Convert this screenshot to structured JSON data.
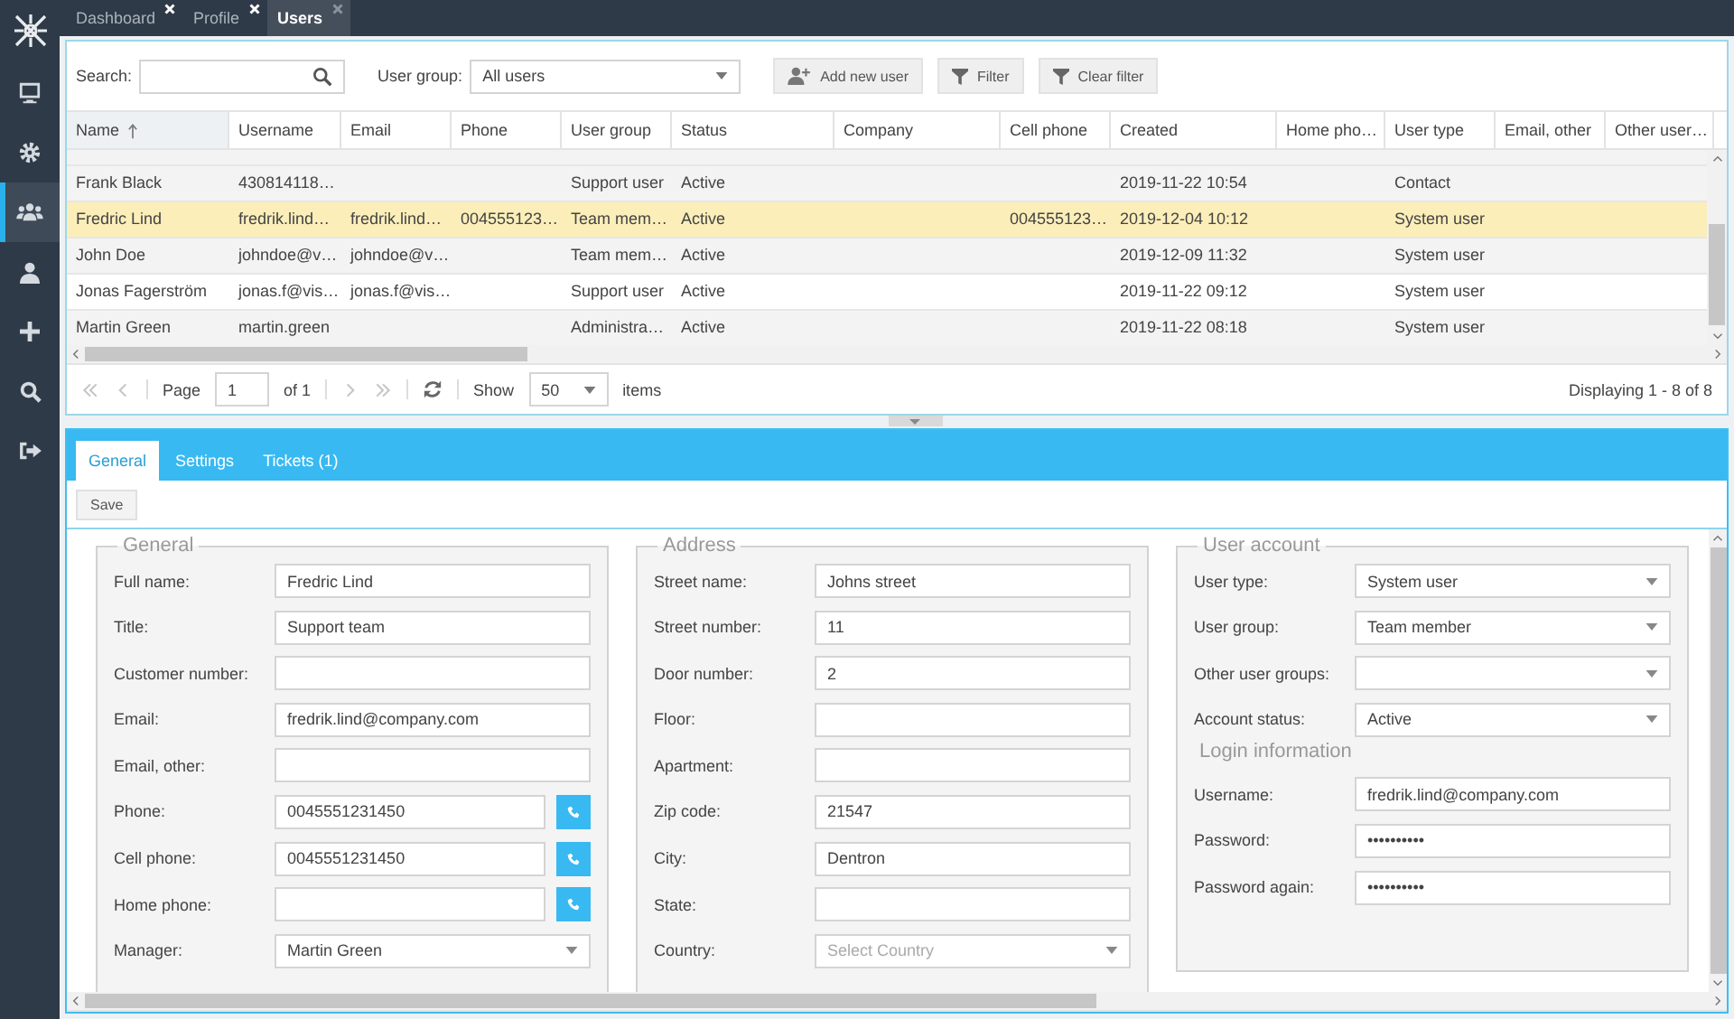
{
  "sidebar": {
    "items": [
      {
        "selected": false
      },
      {
        "selected": false
      },
      {
        "selected": true
      },
      {
        "selected": false
      },
      {
        "selected": false
      },
      {
        "selected": false
      },
      {
        "selected": false
      }
    ]
  },
  "tabs": [
    {
      "label": "Dashboard",
      "selected": false
    },
    {
      "label": "Profile",
      "selected": false
    },
    {
      "label": "Users",
      "selected": true
    }
  ],
  "toolbar": {
    "search_label": "Search:",
    "group_label": "User group:",
    "group_value": "All users",
    "buttons": [
      {
        "label": "Add new user"
      },
      {
        "label": "Filter"
      },
      {
        "label": "Clear filter"
      }
    ]
  },
  "table": {
    "columns": [
      {
        "label": "Name",
        "sorted": true
      },
      {
        "label": "Username",
        "sorted": false
      },
      {
        "label": "Email",
        "sorted": false
      },
      {
        "label": "Phone",
        "sorted": false
      },
      {
        "label": "User group",
        "sorted": false
      },
      {
        "label": "Status",
        "sorted": false
      },
      {
        "label": "Company",
        "sorted": false
      },
      {
        "label": "Cell phone",
        "sorted": false
      },
      {
        "label": "Created",
        "sorted": false
      },
      {
        "label": "Home pho…",
        "sorted": false
      },
      {
        "label": "User type",
        "sorted": false
      },
      {
        "label": "Email, other",
        "sorted": false
      },
      {
        "label": "Other user…",
        "sorted": false
      }
    ],
    "rows": [
      {
        "selected": false,
        "cells": [
          "Frank Black",
          "430814118…",
          null,
          null,
          "Support user",
          "Active",
          null,
          null,
          "2019-11-22 10:54",
          null,
          "Contact",
          null,
          null
        ]
      },
      {
        "selected": true,
        "cells": [
          "Fredric Lind",
          "fredrik.lind…",
          "fredrik.lind…",
          "004555123…",
          "Team mem…",
          "Active",
          null,
          "004555123…",
          "2019-12-04 10:12",
          null,
          "System user",
          null,
          null
        ]
      },
      {
        "selected": false,
        "cells": [
          "John Doe",
          "johndoe@v…",
          "johndoe@v…",
          null,
          "Team mem…",
          "Active",
          null,
          null,
          "2019-12-09 11:32",
          null,
          "System user",
          null,
          null
        ]
      },
      {
        "selected": false,
        "cells": [
          "Jonas Fagerström",
          "jonas.f@vis…",
          "jonas.f@vis…",
          null,
          "Support user",
          "Active",
          null,
          null,
          "2019-11-22 09:12",
          null,
          "System user",
          null,
          null
        ]
      },
      {
        "selected": false,
        "cells": [
          "Martin Green",
          "martin.green",
          null,
          null,
          "Administra…",
          "Active",
          null,
          null,
          "2019-11-22 08:18",
          null,
          "System user",
          null,
          null
        ]
      }
    ]
  },
  "pager": {
    "nav": [
      {
        "kind": "first",
        "disabled": true
      },
      {
        "kind": "prev",
        "disabled": true
      },
      {
        "kind": "next",
        "disabled": true
      },
      {
        "kind": "last",
        "disabled": true
      }
    ],
    "page_label": "Page",
    "page": "1",
    "of": "of 1",
    "show_label": "Show",
    "page_size": "50",
    "items_label": "items",
    "summary": "Displaying 1 - 8 of 8"
  },
  "detail": {
    "tabs": [
      {
        "label": "General",
        "selected": true
      },
      {
        "label": "Settings",
        "selected": false
      },
      {
        "label": "Tickets (1)",
        "selected": false
      }
    ],
    "save": "Save",
    "fieldsets": [
      {
        "legend": "General",
        "fields": [
          {
            "kind": "text",
            "label": "Full name:",
            "value": "Fredric Lind"
          },
          {
            "kind": "text",
            "label": "Title:",
            "value": "Support team"
          },
          {
            "kind": "text",
            "label": "Customer number:"
          },
          {
            "kind": "text",
            "label": "Email:",
            "value": "fredrik.lind@company.com"
          },
          {
            "kind": "text",
            "label": "Email, other:"
          },
          {
            "kind": "phone",
            "label": "Phone:",
            "value": "0045551231450"
          },
          {
            "kind": "phone",
            "label": "Cell phone:",
            "value": "0045551231450"
          },
          {
            "kind": "phone",
            "label": "Home phone:"
          },
          {
            "kind": "select",
            "label": "Manager:",
            "value": "Martin Green"
          }
        ]
      },
      {
        "legend": "Address",
        "fields": [
          {
            "kind": "text",
            "label": "Street name:",
            "value": "Johns street"
          },
          {
            "kind": "text",
            "label": "Street number:",
            "value": "11"
          },
          {
            "kind": "text",
            "label": "Door number:",
            "value": "2"
          },
          {
            "kind": "text",
            "label": "Floor:"
          },
          {
            "kind": "text",
            "label": "Apartment:"
          },
          {
            "kind": "text",
            "label": "Zip code:",
            "value": "21547"
          },
          {
            "kind": "text",
            "label": "City:",
            "value": "Dentron"
          },
          {
            "kind": "text",
            "label": "State:"
          },
          {
            "kind": "select",
            "label": "Country:",
            "placeholder": "Select Country"
          }
        ]
      },
      {
        "legend": "User account",
        "fields": [
          {
            "kind": "select",
            "label": "User type:",
            "value": "System user"
          },
          {
            "kind": "select",
            "label": "User group:",
            "value": "Team member"
          },
          {
            "kind": "select",
            "label": "Other user groups:"
          },
          {
            "kind": "select",
            "label": "Account status:",
            "value": "Active"
          },
          {
            "kind": "heading",
            "label": "Login information"
          },
          {
            "kind": "text",
            "label": "Username:",
            "value": "fredrik.lind@company.com"
          },
          {
            "kind": "text",
            "label": "Password:",
            "value": "••••••••••"
          },
          {
            "kind": "text",
            "label": "Password again:",
            "value": "••••••••••"
          }
        ]
      }
    ]
  }
}
